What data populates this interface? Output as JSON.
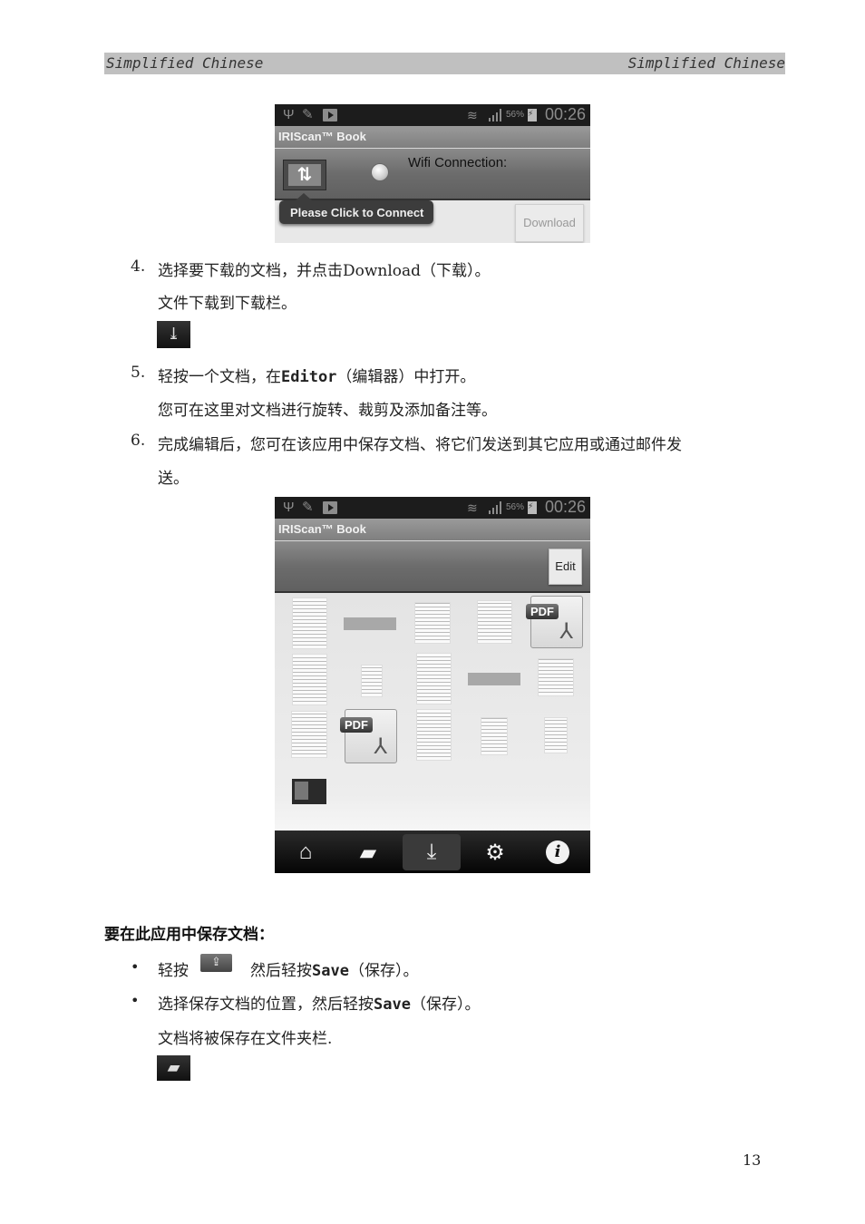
{
  "page_header": {
    "left": "Simplified Chinese",
    "right": "Simplified Chinese"
  },
  "screenshot1": {
    "status_bar": {
      "icons": [
        "usb-icon",
        "pencil-icon",
        "play-store-icon",
        "wifi-icon",
        "signal-icon",
        "battery-charging-icon"
      ],
      "battery": "56%",
      "time": "00:26"
    },
    "app_title": "IRIScan™ Book",
    "sync_icon": "⇅",
    "wifi_label": "Wifi Connection:",
    "tooltip": "Please Click to Connect",
    "download_button": "Download"
  },
  "steps": [
    {
      "number": "4.",
      "text_a": "选择要下载的文档，并点击Download（下载）。",
      "sub": "文件下载到下载栏。"
    },
    {
      "number": "5.",
      "text_a": "轻按一个文档，在",
      "keyword": "Editor",
      "text_b": "（编辑器）中打开。",
      "sub": "您可在这里对文档进行旋转、裁剪及添加备注等。"
    },
    {
      "number": "6.",
      "text_a": "完成编辑后，您可在该应用中保存文档、将它们发送到其它应用或通过邮件发",
      "continuation": "送。"
    }
  ],
  "screenshot2": {
    "status_bar": {
      "battery": "56%",
      "time": "00:26"
    },
    "app_title": "IRIScan™ Book",
    "edit_button": "Edit",
    "thumbnails": [
      {
        "type": "doc"
      },
      {
        "type": "wide"
      },
      {
        "type": "doc"
      },
      {
        "type": "doc"
      },
      {
        "type": "pdf",
        "label": "PDF"
      },
      {
        "type": "doc"
      },
      {
        "type": "doc"
      },
      {
        "type": "doc"
      },
      {
        "type": "wide"
      },
      {
        "type": "doc"
      },
      {
        "type": "doc"
      },
      {
        "type": "pdf",
        "label": "PDF"
      },
      {
        "type": "doc"
      },
      {
        "type": "doc"
      },
      {
        "type": "doc"
      },
      {
        "type": "dark"
      }
    ],
    "nav": [
      {
        "name": "home-icon",
        "glyph": "⌂"
      },
      {
        "name": "folder-icon",
        "glyph": "▰"
      },
      {
        "name": "download-icon",
        "glyph": "⤓",
        "active": true
      },
      {
        "name": "settings-icon",
        "glyph": "⚙"
      },
      {
        "name": "info-icon",
        "glyph": "i"
      }
    ]
  },
  "download_icon_glyph": "⤓",
  "save_section": {
    "title": "要在此应用中保存文档：",
    "bullets": [
      {
        "a": "轻按",
        "icon": "share-icon",
        "icon_glyph": "⇪",
        "b": "然后轻按",
        "keyword": "Save",
        "c": "（保存）。"
      },
      {
        "a": "选择保存文档的位置，然后轻按",
        "keyword": "Save",
        "c": "（保存）。"
      }
    ],
    "note": "文档将被保存在文件夹栏.",
    "folder_icon_glyph": "▰"
  },
  "page_number": "13"
}
